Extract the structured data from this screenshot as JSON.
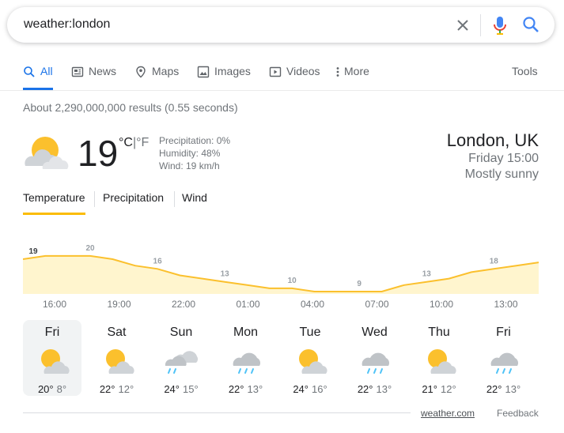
{
  "search": {
    "query": "weather:london"
  },
  "tabs": [
    {
      "label": "All",
      "icon": "search-icon",
      "active": true
    },
    {
      "label": "News",
      "icon": "news-icon"
    },
    {
      "label": "Maps",
      "icon": "map-pin-icon"
    },
    {
      "label": "Images",
      "icon": "image-icon"
    },
    {
      "label": "Videos",
      "icon": "video-icon"
    },
    {
      "label": "More",
      "icon": "more-vert-icon"
    }
  ],
  "tools_label": "Tools",
  "stats": "About 2,290,000,000 results (0.55 seconds)",
  "current": {
    "temp": "19",
    "unit_c": "°C",
    "unit_sep": "|",
    "unit_f": "°F",
    "precipitation": "Precipitation: 0%",
    "humidity": "Humidity: 48%",
    "wind": "Wind: 19 km/h",
    "icon": "partly-sunny-icon"
  },
  "location": {
    "city": "London, UK",
    "time": "Friday 15:00",
    "condition": "Mostly sunny"
  },
  "chart_tabs": [
    "Temperature",
    "Precipitation",
    "Wind"
  ],
  "colors": {
    "accent_blue": "#1a73e8",
    "chart_line": "#fbc02d",
    "chart_fill": "#fff5ce",
    "rain": "#4fc3f7"
  },
  "chart_data": {
    "type": "area",
    "x": [
      "15:00",
      "16:00",
      "17:00",
      "18:00",
      "19:00",
      "20:00",
      "21:00",
      "22:00",
      "23:00",
      "00:00",
      "01:00",
      "02:00",
      "03:00",
      "04:00",
      "05:00",
      "06:00",
      "07:00",
      "08:00",
      "09:00",
      "10:00",
      "11:00",
      "12:00",
      "13:00",
      "14:00"
    ],
    "values": [
      19,
      20,
      20,
      20,
      19,
      17,
      16,
      14,
      13,
      12,
      11,
      10,
      10,
      9,
      9,
      9,
      9,
      11,
      12,
      13,
      15,
      16,
      17,
      18
    ],
    "labels": [
      {
        "index": 0,
        "text": "19"
      },
      {
        "index": 3,
        "text": "20"
      },
      {
        "index": 6,
        "text": "16"
      },
      {
        "index": 9,
        "text": "13"
      },
      {
        "index": 12,
        "text": "10"
      },
      {
        "index": 15,
        "text": "9"
      },
      {
        "index": 18,
        "text": "13"
      },
      {
        "index": 21,
        "text": "18"
      }
    ],
    "hour_ticks": [
      "16:00",
      "19:00",
      "22:00",
      "01:00",
      "04:00",
      "07:00",
      "10:00",
      "13:00"
    ]
  },
  "forecast": [
    {
      "day": "Fri",
      "high": "20°",
      "low": "8°",
      "icon": "partly-sunny-icon",
      "selected": true
    },
    {
      "day": "Sat",
      "high": "22°",
      "low": "12°",
      "icon": "partly-sunny-icon"
    },
    {
      "day": "Sun",
      "high": "24°",
      "low": "15°",
      "icon": "rain-showers-icon"
    },
    {
      "day": "Mon",
      "high": "22°",
      "low": "13°",
      "icon": "rain-icon"
    },
    {
      "day": "Tue",
      "high": "24°",
      "low": "16°",
      "icon": "partly-sunny-icon"
    },
    {
      "day": "Wed",
      "high": "22°",
      "low": "13°",
      "icon": "rain-icon"
    },
    {
      "day": "Thu",
      "high": "21°",
      "low": "12°",
      "icon": "partly-sunny-icon"
    },
    {
      "day": "Fri",
      "high": "22°",
      "low": "13°",
      "icon": "rain-icon"
    }
  ],
  "footer": {
    "source": "weather.com",
    "feedback": "Feedback"
  }
}
